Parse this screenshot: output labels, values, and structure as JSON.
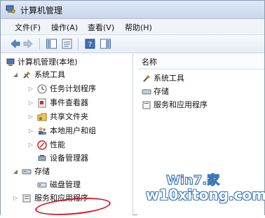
{
  "window": {
    "title": "计算机管理"
  },
  "menu": [
    "文件(F)",
    "操作(A)",
    "查看(V)",
    "帮助(H)"
  ],
  "tree": {
    "root": "计算机管理(本地)",
    "system_tools": "系统工具",
    "items": [
      "任务计划程序",
      "事件查看器",
      "共享文件夹",
      "本地用户和组",
      "性能",
      "设备管理器"
    ],
    "storage": "存储",
    "disk_management": "磁盘管理",
    "services_apps": "服务和应用程序"
  },
  "right_pane": {
    "header": "名称",
    "items": [
      "系统工具",
      "存储",
      "服务和应用程序"
    ]
  },
  "watermark": {
    "top": "Win7.家",
    "bottom": "w10xitong.com"
  },
  "colors": {
    "highlight_oval": "#d51b24"
  }
}
